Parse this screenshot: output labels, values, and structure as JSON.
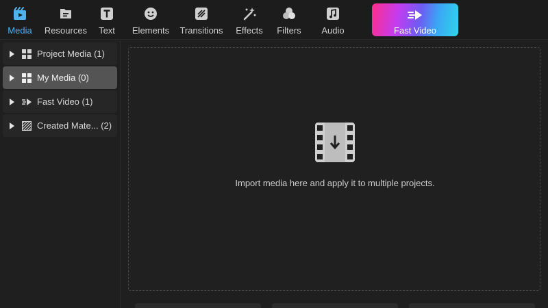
{
  "toolbar": {
    "tabs": [
      {
        "label": "Media",
        "icon": "media-icon"
      },
      {
        "label": "Resources",
        "icon": "resources-icon"
      },
      {
        "label": "Text",
        "icon": "text-icon"
      },
      {
        "label": "Elements",
        "icon": "elements-icon"
      },
      {
        "label": "Transitions",
        "icon": "transitions-icon"
      },
      {
        "label": "Effects",
        "icon": "effects-icon"
      },
      {
        "label": "Filters",
        "icon": "filters-icon"
      },
      {
        "label": "Audio",
        "icon": "audio-icon"
      }
    ],
    "active_tab": "Media",
    "fast_video": {
      "label": "Fast Video",
      "icon": "fast-video-icon"
    }
  },
  "sidebar": {
    "items": [
      {
        "label": "Project Media (1)",
        "icon": "grid-icon"
      },
      {
        "label": "My Media (0)",
        "icon": "grid-icon",
        "selected": true
      },
      {
        "label": "Fast Video (1)",
        "icon": "fast-arrow-icon"
      },
      {
        "label": "Created Mate... (2)",
        "icon": "pattern-icon"
      }
    ]
  },
  "dropzone": {
    "hint": "Import media here and apply it to multiple projects.",
    "icon": "film-import-icon"
  },
  "colors": {
    "accent": "#4fb3ef",
    "background": "#1f1f1f",
    "selected_item": "#545454"
  }
}
